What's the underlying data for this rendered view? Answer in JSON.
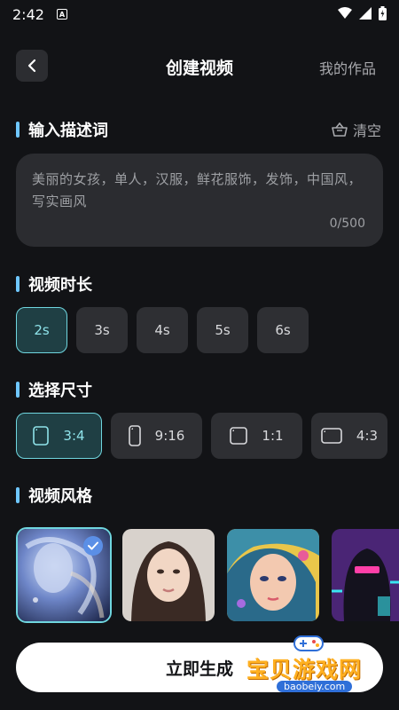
{
  "status_bar": {
    "time": "2:42"
  },
  "header": {
    "title": "创建视频",
    "my_works": "我的作品"
  },
  "prompt_section": {
    "title": "输入描述词",
    "clear_label": "清空",
    "prompt_text": "美丽的女孩，单人，汉服，鲜花服饰，发饰，中国风，写实画风",
    "char_count": "0/500"
  },
  "duration_section": {
    "title": "视频时长",
    "options": [
      "2s",
      "3s",
      "4s",
      "5s",
      "6s"
    ],
    "selected": "2s"
  },
  "size_section": {
    "title": "选择尺寸",
    "options": [
      "3:4",
      "9:16",
      "1:1",
      "4:3"
    ],
    "selected": "3:4"
  },
  "style_section": {
    "title": "视频风格",
    "items": [
      "ethereal-blue-girl",
      "realistic-portrait",
      "colorful-anime-girl",
      "cyberpunk-hooded-figure"
    ],
    "selected_index": 0
  },
  "generate_button": {
    "label": "立即生成"
  },
  "watermark": {
    "text": "宝贝游戏网",
    "domain": "baobeiy.com"
  },
  "colors": {
    "accent": "#6fd6df",
    "section_bar": "#6fc7ff",
    "background": "#121316"
  }
}
